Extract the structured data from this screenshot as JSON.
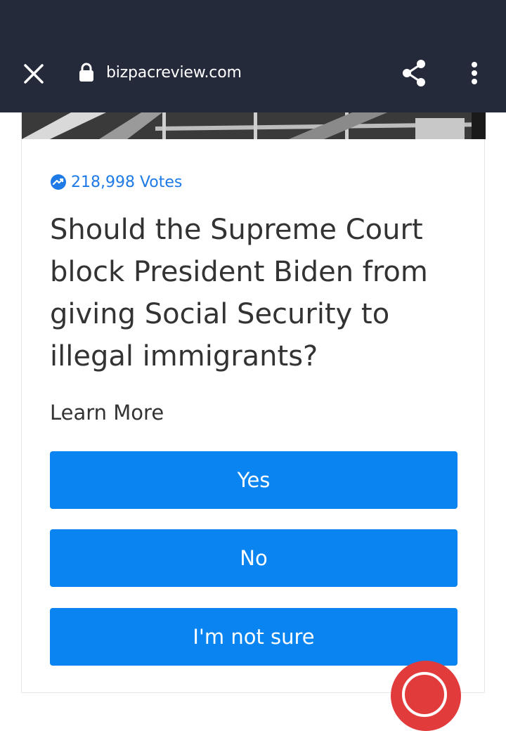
{
  "browser": {
    "url": "bizpacreview.com",
    "icons": {
      "close": "close-icon",
      "lock": "lock-icon",
      "share": "share-icon",
      "menu": "more-vert-icon"
    },
    "bar_color": "#252a3b"
  },
  "poll": {
    "votes_label": "218,998 Votes",
    "votes_icon": "trending-up-icon",
    "question": "Should the Supreme Court block President Biden from giving Social Security to illegal immigrants?",
    "learn_more": "Learn More",
    "options": [
      "Yes",
      "No",
      "I'm not sure"
    ],
    "accent_color": "#0a84f0"
  }
}
